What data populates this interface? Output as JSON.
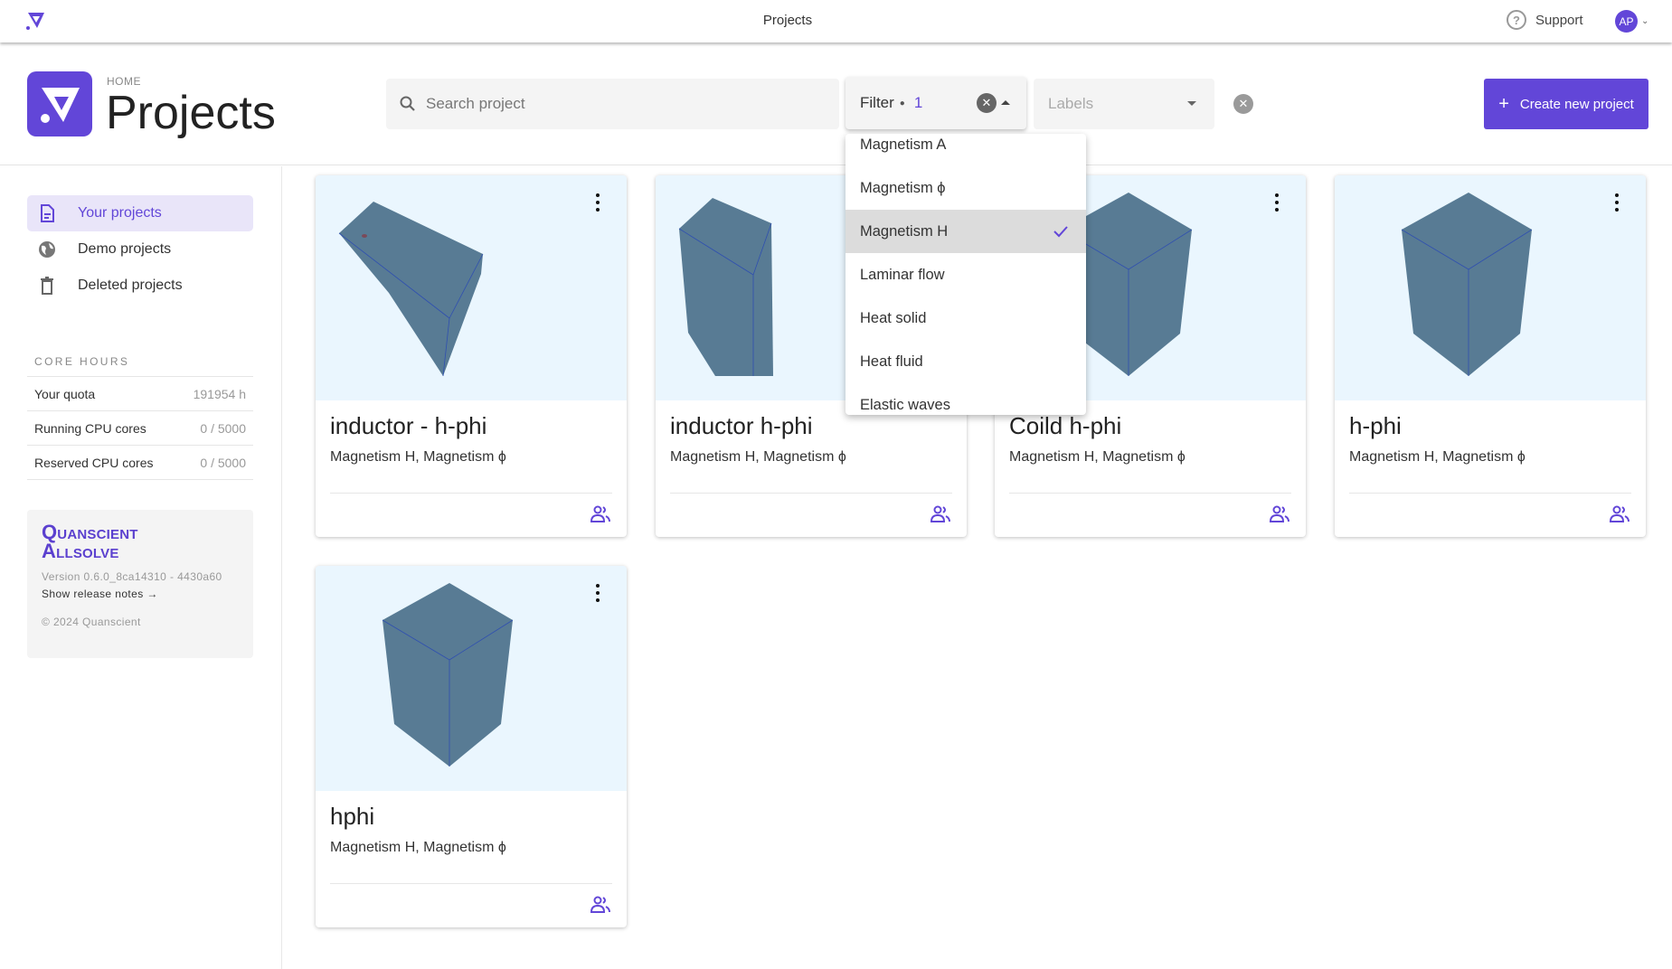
{
  "topbar": {
    "title": "Projects",
    "support_label": "Support",
    "avatar_initials": "AP"
  },
  "header": {
    "breadcrumb": "HOME",
    "title": "Projects",
    "search_placeholder": "Search project",
    "search_value": "",
    "filter_label": "Filter",
    "filter_count": "1",
    "labels_placeholder": "Labels",
    "create_label": "Create new project"
  },
  "sidebar": {
    "items": [
      {
        "label": "Your projects",
        "icon": "document-icon",
        "active": true
      },
      {
        "label": "Demo projects",
        "icon": "globe-icon",
        "active": false
      },
      {
        "label": "Deleted projects",
        "icon": "trash-icon",
        "active": false
      }
    ],
    "core_hours": {
      "title": "CORE HOURS",
      "rows": [
        {
          "label": "Your quota",
          "value": "191954 h"
        },
        {
          "label": "Running CPU cores",
          "value": "0 / 5000"
        },
        {
          "label": "Reserved CPU cores",
          "value": "0 / 5000"
        }
      ]
    },
    "brand": {
      "line1": "Quanscient",
      "line2": "Allsolve",
      "version": "Version 0.6.0_8ca14310 - 4430a60",
      "release_notes": "Show release notes →",
      "copyright": "© 2024 Quanscient"
    }
  },
  "filter_dropdown": {
    "options": [
      {
        "label": "Magnetism A",
        "selected": false
      },
      {
        "label": "Magnetism ϕ",
        "selected": false
      },
      {
        "label": "Magnetism H",
        "selected": true
      },
      {
        "label": "Laminar flow",
        "selected": false
      },
      {
        "label": "Heat solid",
        "selected": false
      },
      {
        "label": "Heat fluid",
        "selected": false
      },
      {
        "label": "Elastic waves",
        "selected": false
      }
    ]
  },
  "projects": [
    {
      "name": "inductor - h-phi",
      "tags": "Magnetism H, Magnetism ϕ",
      "shape": "box"
    },
    {
      "name": "inductor h-phi",
      "tags": "Magnetism H, Magnetism ϕ",
      "shape": "tall"
    },
    {
      "name": "Coild h-phi",
      "tags": "Magnetism H, Magnetism ϕ",
      "shape": "cube"
    },
    {
      "name": "h-phi",
      "tags": "Magnetism H, Magnetism ϕ",
      "shape": "cube"
    },
    {
      "name": "hphi",
      "tags": "Magnetism H, Magnetism ϕ",
      "shape": "cube"
    }
  ],
  "colors": {
    "accent": "#6246d8",
    "thumb_bg": "#eaf6fe",
    "model_fill": "#587b94",
    "model_edge": "#2f4fb0"
  }
}
